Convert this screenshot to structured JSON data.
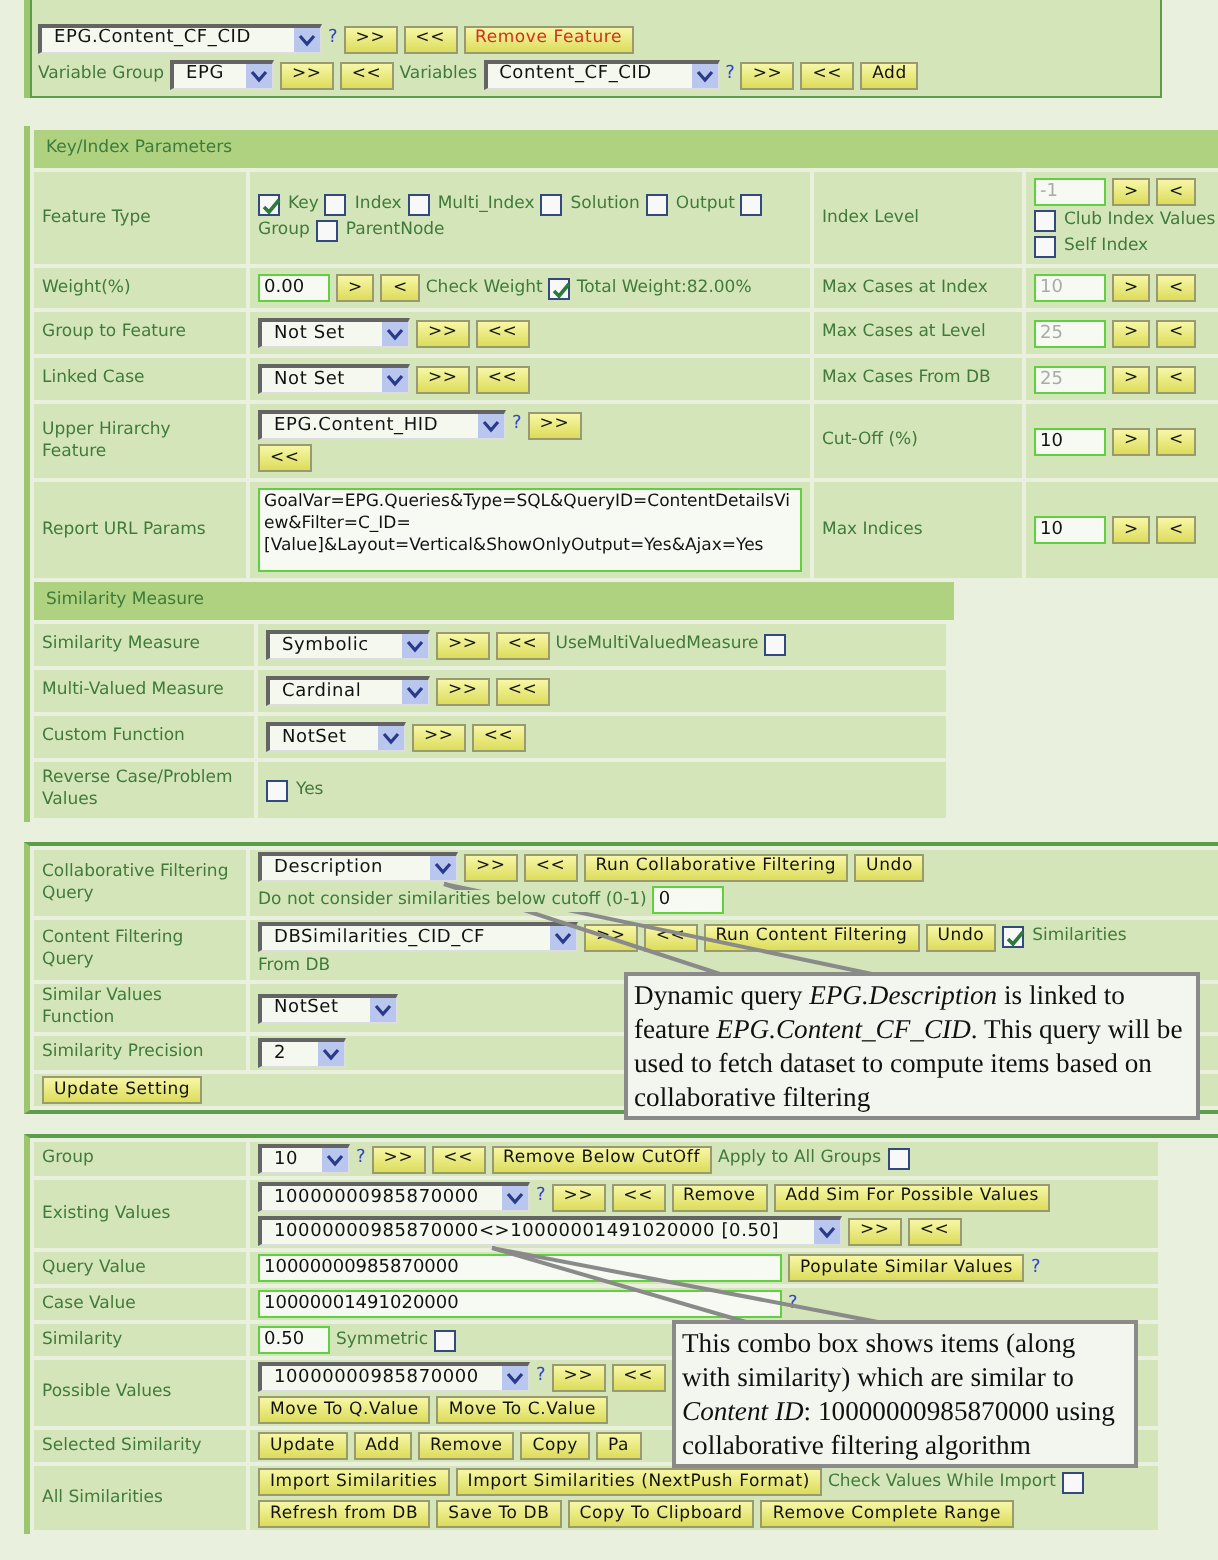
{
  "top_panel": {
    "rows": [
      {
        "controls": [
          {
            "kind": "select",
            "value": "EPG.Content_CF_CID"
          },
          {
            "kind": "help",
            "text": "?"
          },
          {
            "kind": "button",
            "text": ">>"
          },
          {
            "kind": "button",
            "text": "<<"
          },
          {
            "kind": "button",
            "text": "Remove Feature",
            "danger": true
          }
        ]
      },
      {
        "controls": [
          {
            "kind": "text",
            "text": "Variable Group"
          },
          {
            "kind": "select",
            "value": "EPG"
          },
          {
            "kind": "button",
            "text": ">>"
          },
          {
            "kind": "button",
            "text": "<<"
          },
          {
            "kind": "text",
            "text": "Variables"
          },
          {
            "kind": "select",
            "value": "Content_CF_CID"
          },
          {
            "kind": "help",
            "text": "?"
          },
          {
            "kind": "button",
            "text": ">>"
          },
          {
            "kind": "button",
            "text": "<<"
          },
          {
            "kind": "button",
            "text": "Add"
          }
        ]
      }
    ]
  },
  "key_index": {
    "title": "Key/Index Parameters",
    "rows": [
      {
        "label": "Feature Type",
        "controls": [
          {
            "kind": "checkbox",
            "label": "Key",
            "checked": true
          },
          {
            "kind": "checkbox",
            "label": "Index",
            "checked": false
          },
          {
            "kind": "checkbox",
            "label": "Multi_Index",
            "checked": false
          },
          {
            "kind": "checkbox",
            "label": "Solution",
            "checked": false
          },
          {
            "kind": "checkbox",
            "label": "Output",
            "checked": false
          },
          {
            "kind": "checkbox",
            "checked": false
          },
          {
            "kind": "break"
          },
          {
            "kind": "text",
            "text": "Group"
          },
          {
            "kind": "checkbox",
            "label": "ParentNode",
            "checked": false
          }
        ],
        "label2": "Index Level",
        "controls2": [
          {
            "kind": "input",
            "value": "-1",
            "disabled": true
          },
          {
            "kind": "button",
            "text": ">"
          },
          {
            "kind": "button",
            "text": "<"
          },
          {
            "kind": "break"
          },
          {
            "kind": "checkbox",
            "label": "Club Index Values",
            "checked": false
          },
          {
            "kind": "break"
          },
          {
            "kind": "checkbox",
            "label": "Self Index",
            "checked": false
          }
        ]
      },
      {
        "label": "Weight(%)",
        "controls": [
          {
            "kind": "input",
            "value": "0.00",
            "disabled": false
          },
          {
            "kind": "button",
            "text": ">"
          },
          {
            "kind": "button",
            "text": "<"
          },
          {
            "kind": "text",
            "text": "Check Weight"
          },
          {
            "kind": "checkbox",
            "checked": true
          },
          {
            "kind": "text",
            "text": "Total Weight:82.00%"
          }
        ],
        "label2": "Max Cases at Index",
        "controls2": [
          {
            "kind": "input",
            "value": "10",
            "disabled": true
          },
          {
            "kind": "button",
            "text": ">"
          },
          {
            "kind": "button",
            "text": "<"
          }
        ]
      },
      {
        "label": "Group to Feature",
        "controls": [
          {
            "kind": "select",
            "value": "Not Set"
          },
          {
            "kind": "button",
            "text": ">>"
          },
          {
            "kind": "button",
            "text": "<<"
          }
        ],
        "label2": "Max Cases at Level",
        "controls2": [
          {
            "kind": "input",
            "value": "25",
            "disabled": true
          },
          {
            "kind": "button",
            "text": ">"
          },
          {
            "kind": "button",
            "text": "<"
          }
        ]
      },
      {
        "label": "Linked Case",
        "controls": [
          {
            "kind": "select",
            "value": "Not Set"
          },
          {
            "kind": "button",
            "text": ">>"
          },
          {
            "kind": "button",
            "text": "<<"
          }
        ],
        "label2": "Max Cases From DB",
        "controls2": [
          {
            "kind": "input",
            "value": "25",
            "disabled": true
          },
          {
            "kind": "button",
            "text": ">"
          },
          {
            "kind": "button",
            "text": "<"
          }
        ]
      },
      {
        "label": "Upper Hirarchy Feature",
        "controls": [
          {
            "kind": "select",
            "value": "EPG.Content_HID"
          },
          {
            "kind": "help",
            "text": "?"
          },
          {
            "kind": "button",
            "text": ">>"
          },
          {
            "kind": "break"
          },
          {
            "kind": "button",
            "text": "<<"
          }
        ],
        "label2": "Cut-Off (%)",
        "controls2": [
          {
            "kind": "input",
            "value": "10",
            "disabled": false
          },
          {
            "kind": "button",
            "text": ">"
          },
          {
            "kind": "button",
            "text": "<"
          }
        ]
      },
      {
        "label": "Report URL Params",
        "controls": [
          {
            "kind": "textarea",
            "value": "GoalVar=EPG.Queries&Type=SQL&QueryID=ContentDetailsView&Filter=C_ID=[Value]&Layout=Vertical&ShowOnlyOutput=Yes&Ajax=Yes"
          }
        ],
        "label2": "Max Indices",
        "controls2": [
          {
            "kind": "input",
            "value": "10",
            "disabled": false
          },
          {
            "kind": "button",
            "text": ">"
          },
          {
            "kind": "button",
            "text": "<"
          }
        ]
      }
    ]
  },
  "similarity_measure": {
    "title": "Similarity Measure",
    "rows": [
      {
        "label": "Similarity Measure",
        "controls": [
          {
            "kind": "select",
            "value": "Symbolic"
          },
          {
            "kind": "button",
            "text": ">>"
          },
          {
            "kind": "button",
            "text": "<<"
          },
          {
            "kind": "text",
            "text": "UseMultiValuedMeasure"
          },
          {
            "kind": "checkbox",
            "checked": false
          }
        ]
      },
      {
        "label": "Multi-Valued Measure",
        "controls": [
          {
            "kind": "select",
            "value": "Cardinal"
          },
          {
            "kind": "button",
            "text": ">>"
          },
          {
            "kind": "button",
            "text": "<<"
          }
        ]
      },
      {
        "label": "Custom Function",
        "controls": [
          {
            "kind": "select",
            "value": "NotSet"
          },
          {
            "kind": "button",
            "text": ">>"
          },
          {
            "kind": "button",
            "text": "<<"
          }
        ]
      },
      {
        "label": "Reverse Case/Problem Values",
        "controls": [
          {
            "kind": "checkbox",
            "label": "Yes",
            "checked": false
          }
        ]
      }
    ]
  },
  "filtering": {
    "rows": [
      {
        "label": "Collaborative Filtering Query",
        "controls": [
          {
            "kind": "select",
            "value": "Description"
          },
          {
            "kind": "button",
            "text": ">>"
          },
          {
            "kind": "button",
            "text": "<<"
          },
          {
            "kind": "button",
            "text": "Run Collaborative Filtering"
          },
          {
            "kind": "button",
            "text": "Undo"
          },
          {
            "kind": "break"
          },
          {
            "kind": "text",
            "text": "Do not consider similarities below cutoff (0-1)"
          },
          {
            "kind": "input",
            "value": "0",
            "disabled": false
          }
        ]
      },
      {
        "label": "Content Filtering Query",
        "controls": [
          {
            "kind": "select",
            "value": "DBSimilarities_CID_CF"
          },
          {
            "kind": "button",
            "text": ">>"
          },
          {
            "kind": "button",
            "text": "<<"
          },
          {
            "kind": "button",
            "text": "Run Content Filtering"
          },
          {
            "kind": "button",
            "text": "Undo"
          },
          {
            "kind": "checkbox",
            "label": "Similarities",
            "checked": true
          },
          {
            "kind": "break"
          },
          {
            "kind": "text",
            "text": "From DB"
          }
        ]
      },
      {
        "label": "Similar Values Function",
        "controls": [
          {
            "kind": "select",
            "value": "NotSet"
          }
        ]
      },
      {
        "label": "Similarity Precision",
        "controls": [
          {
            "kind": "select",
            "value": "2"
          }
        ]
      }
    ],
    "button": "Update Setting"
  },
  "values": {
    "rows": [
      {
        "label": "Group",
        "controls": [
          {
            "kind": "select",
            "value": "10"
          },
          {
            "kind": "help",
            "text": "?"
          },
          {
            "kind": "button",
            "text": ">>"
          },
          {
            "kind": "button",
            "text": "<<"
          },
          {
            "kind": "button",
            "text": "Remove Below CutOff"
          },
          {
            "kind": "text",
            "text": "Apply to All Groups"
          },
          {
            "kind": "checkbox",
            "checked": false
          }
        ]
      },
      {
        "label": "Existing Values",
        "controls": [
          {
            "kind": "select",
            "value": "10000000985870000"
          },
          {
            "kind": "help",
            "text": "?"
          },
          {
            "kind": "button",
            "text": ">>"
          },
          {
            "kind": "button",
            "text": "<<"
          },
          {
            "kind": "button",
            "text": "Remove"
          },
          {
            "kind": "button",
            "text": "Add Sim For Possible Values"
          },
          {
            "kind": "break"
          },
          {
            "kind": "select",
            "value": "10000000985870000<>10000001491020000 [0.50]"
          },
          {
            "kind": "button",
            "text": ">>"
          },
          {
            "kind": "button",
            "text": "<<"
          }
        ]
      },
      {
        "label": "Query Value",
        "controls": [
          {
            "kind": "field",
            "value": "10000000985870000",
            "disabled": false
          },
          {
            "kind": "button",
            "text": "Populate Similar Values"
          },
          {
            "kind": "help",
            "text": "?"
          }
        ]
      },
      {
        "label": "Case Value",
        "controls": [
          {
            "kind": "field",
            "value": "10000001491020000",
            "disabled": false
          },
          {
            "kind": "help",
            "text": "?"
          }
        ]
      },
      {
        "label": "Similarity",
        "controls": [
          {
            "kind": "input",
            "value": "0.50",
            "disabled": false
          },
          {
            "kind": "text",
            "text": "Symmetric"
          },
          {
            "kind": "checkbox",
            "checked": false
          }
        ]
      },
      {
        "label": "Possible Values",
        "controls": [
          {
            "kind": "select",
            "value": "10000000985870000"
          },
          {
            "kind": "help",
            "text": "?"
          },
          {
            "kind": "button",
            "text": ">>"
          },
          {
            "kind": "button",
            "text": "<<"
          },
          {
            "kind": "break"
          },
          {
            "kind": "button",
            "text": "Move To Q.Value"
          },
          {
            "kind": "button",
            "text": "Move To C.Value"
          }
        ]
      },
      {
        "label": "Selected Similarity",
        "controls": [
          {
            "kind": "button",
            "text": "Update"
          },
          {
            "kind": "button",
            "text": "Add"
          },
          {
            "kind": "button",
            "text": "Remove"
          },
          {
            "kind": "button",
            "text": "Copy"
          },
          {
            "kind": "button",
            "text": "Pa"
          }
        ]
      },
      {
        "label": "All Similarities",
        "controls": [
          {
            "kind": "button",
            "text": "Import Similarities"
          },
          {
            "kind": "button",
            "text": "Import Similarities (NextPush Format)"
          },
          {
            "kind": "text",
            "text": "Check Values While Import"
          },
          {
            "kind": "checkbox",
            "checked": false
          },
          {
            "kind": "break"
          },
          {
            "kind": "button",
            "text": "Refresh from DB"
          },
          {
            "kind": "button",
            "text": "Save To DB"
          },
          {
            "kind": "button",
            "text": "Copy To Clipboard"
          },
          {
            "kind": "button",
            "text": "Remove Complete Range"
          }
        ]
      }
    ]
  },
  "callouts": [
    {
      "text": "Dynamic query *EPG.Description* is linked to feature *EPG.Content_CF_CID*. This query will be used to fetch dataset to compute items based on collaborative filtering"
    },
    {
      "text": "This combo box shows items (along with similarity) which are similar to *Content ID*: 10000000985870000 using collaborative filtering algorithm"
    }
  ]
}
